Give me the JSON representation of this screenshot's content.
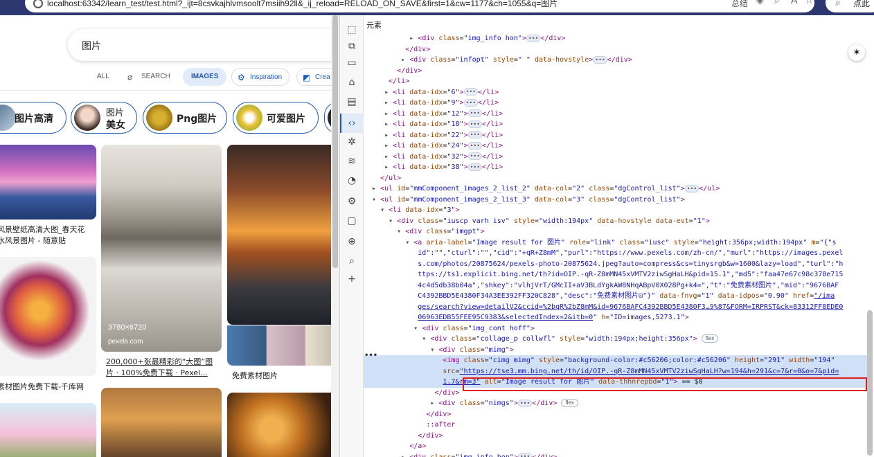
{
  "browser": {
    "address": "localhost:63342/learn_test/test.html?_ijt=8csvkajhlvmsoolt7msiih92ll&_ij_reload=RELOAD_ON_SAVE&first=1&cw=1177&ch=1055&q=图片",
    "address_right": "总结",
    "side_search": "点此"
  },
  "search": {
    "query": "图片",
    "tabs": [
      "ALL",
      "SEARCH",
      "IMAGES",
      "Inspiration",
      "Crea"
    ]
  },
  "chips": [
    "图片高清",
    "图片",
    "美女",
    "Png图片",
    "可爱图片"
  ],
  "results": {
    "col1_caption_1": "风景壁纸高清大图_春天花",
    "col1_caption_2": "水风景图片 - 随意贴",
    "col1_caption_3": "素材图片免费下载-千库网",
    "col2_resolution": "3780×6720",
    "col2_source": "pexels.com",
    "col2_caption_1": "200,000+张最精彩的“大图”图",
    "col2_caption_2": "片 · 100%免费下载 · Pexel...",
    "col3_caption": "免费素材图片"
  },
  "devtools": {
    "title": "元素",
    "close_icon": "×",
    "dots": "•••"
  },
  "colors": {
    "accent": "#1a5ab8",
    "highlight_row": "#cfe0f7",
    "highlight_box": "#e02020"
  }
}
